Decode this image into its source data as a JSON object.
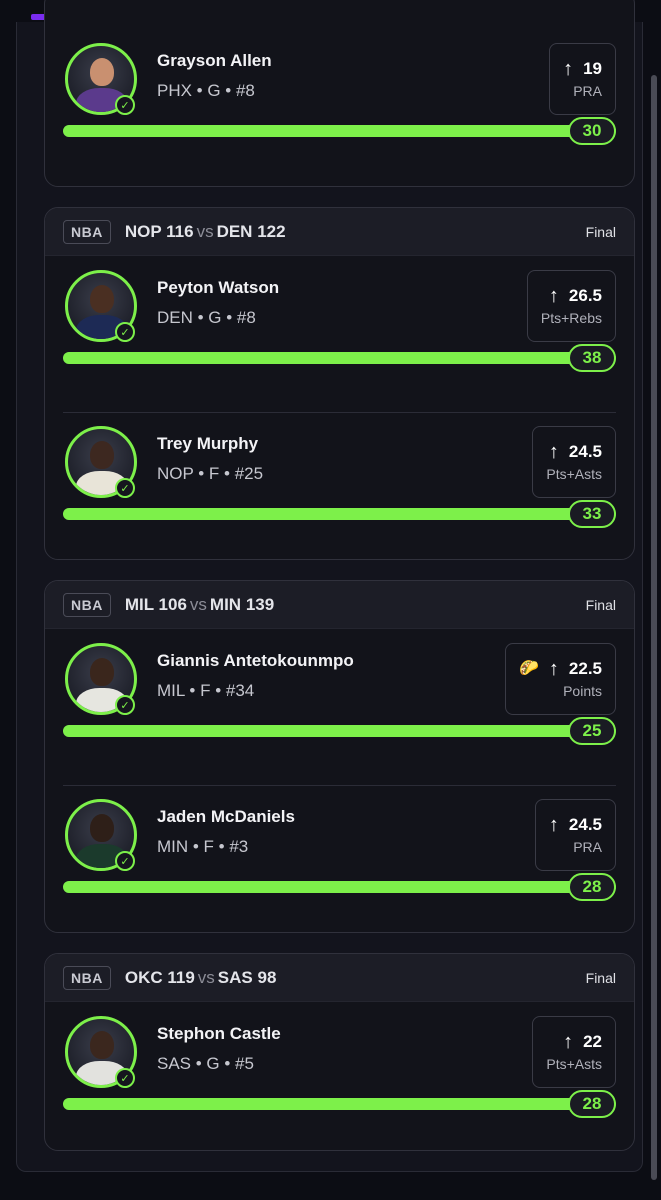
{
  "colors": {
    "accent": "#7df04a",
    "top_progress": "#7a2cf0",
    "background": "#0c0d14",
    "card": "#12131a"
  },
  "icons": {
    "up_arrow": "↑",
    "check": "✓",
    "taco": "🌮"
  },
  "top_card": {
    "player": {
      "name": "Grayson Allen",
      "info": "PHX • G • #8",
      "prop_line": "19",
      "prop_stat": "PRA",
      "result": "30",
      "progress": 1.0
    }
  },
  "games": [
    {
      "league": "NBA",
      "away_team": "NOP",
      "away_score": "116",
      "vs": "vs",
      "home_team": "DEN",
      "home_score": "122",
      "status": "Final",
      "players": [
        {
          "name": "Peyton Watson",
          "info": "DEN • G • #8",
          "prop_line": "26.5",
          "prop_stat": "Pts+Rebs",
          "result": "38",
          "progress": 1.0
        },
        {
          "name": "Trey Murphy",
          "info": "NOP • F • #25",
          "prop_line": "24.5",
          "prop_stat": "Pts+Asts",
          "result": "33",
          "progress": 1.0
        }
      ]
    },
    {
      "league": "NBA",
      "away_team": "MIL",
      "away_score": "106",
      "vs": "vs",
      "home_team": "MIN",
      "home_score": "139",
      "status": "Final",
      "players": [
        {
          "name": "Giannis Antetokounmpo",
          "info": "MIL • F • #34",
          "prop_line": "22.5",
          "prop_stat": "Points",
          "result": "25",
          "progress": 1.0,
          "has_taco": true
        },
        {
          "name": "Jaden McDaniels",
          "info": "MIN • F • #3",
          "prop_line": "24.5",
          "prop_stat": "PRA",
          "result": "28",
          "progress": 1.0
        }
      ]
    },
    {
      "league": "NBA",
      "away_team": "OKC",
      "away_score": "119",
      "vs": "vs",
      "home_team": "SAS",
      "home_score": "98",
      "status": "Final",
      "players": [
        {
          "name": "Stephon Castle",
          "info": "SAS • G • #5",
          "prop_line": "22",
          "prop_stat": "Pts+Asts",
          "result": "28",
          "progress": 1.0
        }
      ]
    }
  ]
}
